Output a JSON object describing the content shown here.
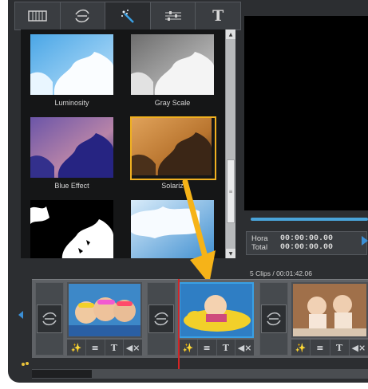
{
  "tabs": [
    {
      "icon": "film-strip-icon"
    },
    {
      "icon": "transition-icon"
    },
    {
      "icon": "magic-wand-icon",
      "active": true
    },
    {
      "icon": "sliders-icon"
    },
    {
      "icon": "text-icon",
      "label": "T"
    }
  ],
  "effects": [
    {
      "label": "Luminosity"
    },
    {
      "label": "Gray Scale"
    },
    {
      "label": "Blue Effect"
    },
    {
      "label": "Solariz",
      "selected": true
    },
    {
      "label": ""
    },
    {
      "label": ""
    }
  ],
  "timecode": {
    "hora_label": "Hora",
    "hora_value": "00:00:00.00",
    "total_label": "Total",
    "total_value": "00:00:00.00"
  },
  "timeline": {
    "info": "5 Clips / 00:01:42.06",
    "clip_controls": [
      "magic-wand-icon",
      "sliders-icon",
      "text-icon",
      "mute-icon"
    ],
    "text_button_label": "T"
  },
  "colors": {
    "selection_border": "#f0b020",
    "drag_arrow": "#f6b318",
    "playhead": "#d42525",
    "accent_blue": "#3aa0e4"
  }
}
